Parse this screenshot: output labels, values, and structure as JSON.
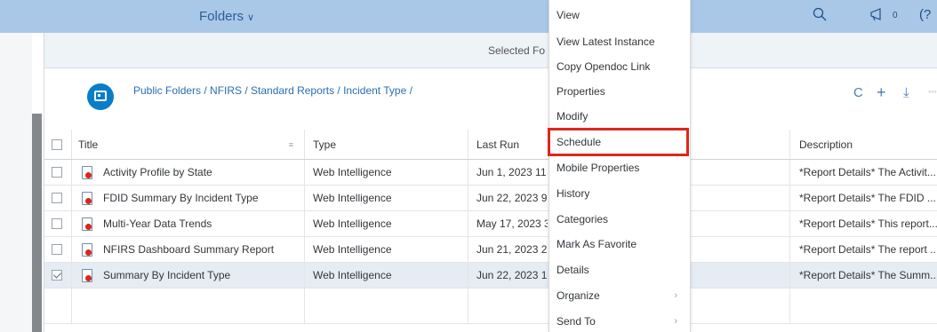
{
  "shellbar": {
    "title": "Folders",
    "chevron": "∨",
    "search_icon": "search-icon",
    "notifications_icon": "megaphone-icon",
    "notification_count": "0",
    "help_icon": "help-icon",
    "help_glyph": "(?"
  },
  "selected_bar": {
    "text": "Selected Fo"
  },
  "breadcrumb": "Public Folders / NFIRS / Standard Reports / Incident Type /",
  "toolbar": {
    "refresh": "C",
    "add": "+",
    "download": "⤓",
    "more": "◦◦◦"
  },
  "table": {
    "columns": [
      "Title",
      "Type",
      "Last Run",
      "Description"
    ],
    "sort_glyph": "≡",
    "rows": [
      {
        "title": "Activity Profile by State",
        "type": "Web Intelligence",
        "last_run": "Jun 1, 2023 11",
        "description": "*Report Details* The Activit...",
        "checked": false
      },
      {
        "title": "FDID Summary By Incident Type",
        "type": "Web Intelligence",
        "last_run": "Jun 22, 2023 9",
        "description": "*Report Details* The FDID ...",
        "checked": false
      },
      {
        "title": "Multi-Year Data Trends",
        "type": "Web Intelligence",
        "last_run": "May 17, 2023 3",
        "description": "*Report Details* This report...",
        "checked": false
      },
      {
        "title": "NFIRS Dashboard Summary Report",
        "type": "Web Intelligence",
        "last_run": "Jun 21, 2023 2",
        "description": "*Report Details* The report ...",
        "checked": false
      },
      {
        "title": "Summary By Incident Type",
        "type": "Web Intelligence",
        "last_run": "Jun 22, 2023 1",
        "description": "*Report Details* The Summ...",
        "checked": true
      }
    ]
  },
  "context_menu": {
    "items": [
      "View",
      "View Latest Instance",
      "Copy Opendoc Link",
      "Properties",
      "Modify",
      "Schedule",
      "Mobile Properties",
      "History",
      "Categories",
      "Mark As Favorite",
      "Details",
      "Organize",
      "Send To"
    ],
    "highlighted": "Schedule",
    "highlight_color": "#e0261c"
  },
  "colors": {
    "shellbar": "#a9c8e7",
    "accent": "#0a7dc8",
    "link": "#2a6eb0"
  }
}
